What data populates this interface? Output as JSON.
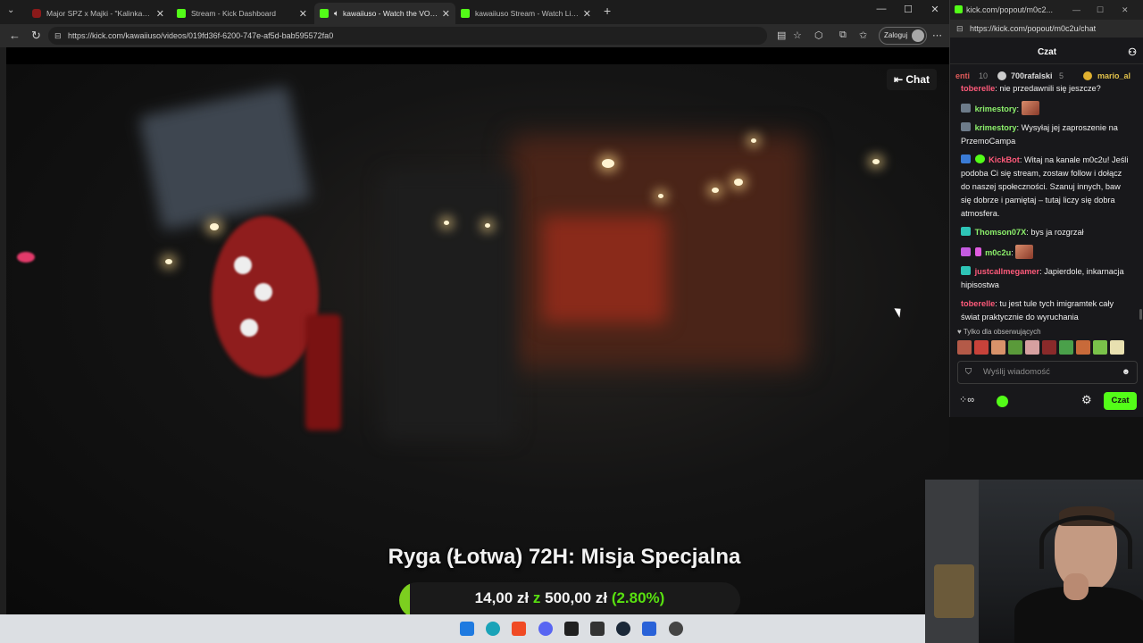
{
  "browser": {
    "tabs": [
      {
        "title": "Major SPZ x Majki - \"Kalinka\" - Yo",
        "favicon": "youtube-icon",
        "active": false
      },
      {
        "title": "Stream - Kick Dashboard",
        "favicon": "kick-icon",
        "active": false
      },
      {
        "title": "kawaiiuso - Watch the VOD o",
        "favicon": "kick-icon",
        "active": true,
        "audio": true
      },
      {
        "title": "kawaiiuso Stream - Watch Live on",
        "favicon": "kick-icon",
        "active": false
      }
    ],
    "url": "https://kick.com/kawaiiuso/videos/019fd36f-6200-747e-af5d-bab595572fa0",
    "login_label": "Zaloguj"
  },
  "video": {
    "chat_toggle_label": "Chat",
    "overlay_title": "Ryga (Łotwa) 72H: Misja Specjalna",
    "goal": {
      "current": "14,00 zł",
      "separator": "z",
      "target": "500,00 zł",
      "percent_text": "(2.80%)",
      "progress": 0.028,
      "accent_color": "#58e010"
    }
  },
  "chat": {
    "window_title": "kick.com/popout/m0c2...",
    "url": "https://kick.com/popout/m0c2u/chat",
    "header": "Czat",
    "leaders": [
      {
        "name": "enti",
        "count": "10"
      },
      {
        "name": "700rafalski",
        "count": "5"
      },
      {
        "name": "mario_al",
        "count": ""
      }
    ],
    "messages": [
      {
        "user": "toberelle",
        "color": "#ff5a7a",
        "text": "nie przedawnili się jeszcze?",
        "badges": []
      },
      {
        "user": "krimestory",
        "color": "#8cf06b",
        "text": "",
        "emote": true,
        "badges": [
          "sub"
        ]
      },
      {
        "user": "krimestory",
        "color": "#8cf06b",
        "text": "Wysyłaj jej zaproszenie na PrzemoCampa",
        "badges": [
          "sub"
        ]
      },
      {
        "user": "KickBot",
        "color": "#ff5a7a",
        "text": "Witaj na kanale m0c2u! Jeśli podoba Ci się stream, zostaw follow i dołącz do naszej społeczności. Szanuj innych, baw się dobrze i pamiętaj – tutaj liczy się dobra atmosfera.",
        "badges": [
          "bot",
          "verified"
        ]
      },
      {
        "user": "Thomson07X",
        "color": "#8cf06b",
        "text": "bys ja rozgrzał",
        "badges": [
          "sub"
        ]
      },
      {
        "user": "m0c2u",
        "color": "#8cf06b",
        "text": "",
        "emote": true,
        "badges": [
          "broadcaster",
          "mic"
        ]
      },
      {
        "user": "justcallmegamer",
        "color": "#ff5a7a",
        "text": "Japierdole, inkarnacja hipisostwa",
        "badges": [
          "sub"
        ]
      },
      {
        "user": "toberelle",
        "color": "#ff5a7a",
        "text": "tu jest tule tych imigramtek cały świat praktycznie do wyruchania",
        "badges": []
      }
    ],
    "followers_only_label": "Tylko dla obserwujących",
    "input_placeholder": "Wyślij wiadomość",
    "send_label": "Czat"
  }
}
